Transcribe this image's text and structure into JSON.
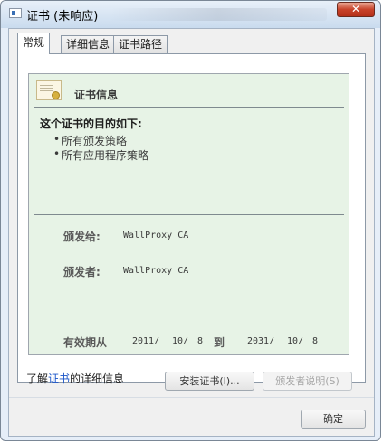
{
  "window": {
    "title": "证书 (未响应)",
    "close_label": "✕"
  },
  "tabs": [
    {
      "label": "常规"
    },
    {
      "label": "详细信息"
    },
    {
      "label": "证书路径"
    }
  ],
  "cert": {
    "heading": "证书信息",
    "purpose_label": "这个证书的目的如下:",
    "purposes": [
      "所有颁发策略",
      "所有应用程序策略"
    ],
    "issued_to_label": "颁发给:",
    "issued_to_value": "WallProxy CA",
    "issued_by_label": "颁发者:",
    "issued_by_value": "WallProxy CA",
    "validity_label": "有效期从",
    "valid_from": [
      "2011/",
      "10/",
      "8"
    ],
    "to_label": "到",
    "valid_to": [
      "2031/",
      "10/",
      "8"
    ]
  },
  "buttons": {
    "install": "安装证书(I)...",
    "issuer_statement": "颁发者说明(S)",
    "ok": "确定"
  },
  "learn_more": {
    "prefix": "了解",
    "link": "证书",
    "suffix": "的详细信息"
  },
  "icons": {
    "window_icon": "certificate-window-icon",
    "cert_icon": "certificate-icon"
  }
}
